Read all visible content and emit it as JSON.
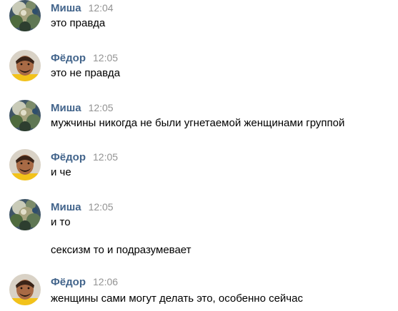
{
  "messages": [
    {
      "author": "Миша",
      "time": "12:04",
      "avatar_icon": "misha-avatar",
      "lines": [
        "это правда"
      ]
    },
    {
      "author": "Фёдор",
      "time": "12:05",
      "avatar_icon": "fedor-avatar",
      "lines": [
        "это не правда"
      ]
    },
    {
      "author": "Миша",
      "time": "12:05",
      "avatar_icon": "misha-avatar",
      "lines": [
        "мужчины никогда не были угнетаемой женщинами группой"
      ]
    },
    {
      "author": "Фёдор",
      "time": "12:05",
      "avatar_icon": "fedor-avatar",
      "lines": [
        "и че"
      ]
    },
    {
      "author": "Миша",
      "time": "12:05",
      "avatar_icon": "misha-avatar",
      "lines": [
        "и то",
        "сексизм то и подразумевает"
      ]
    },
    {
      "author": "Фёдор",
      "time": "12:06",
      "avatar_icon": "fedor-avatar",
      "lines": [
        "женщины сами могут делать это, особенно сейчас"
      ]
    }
  ],
  "colors": {
    "author_link": "#42648b",
    "timestamp": "#939393",
    "text": "#000000",
    "background": "#ffffff"
  }
}
